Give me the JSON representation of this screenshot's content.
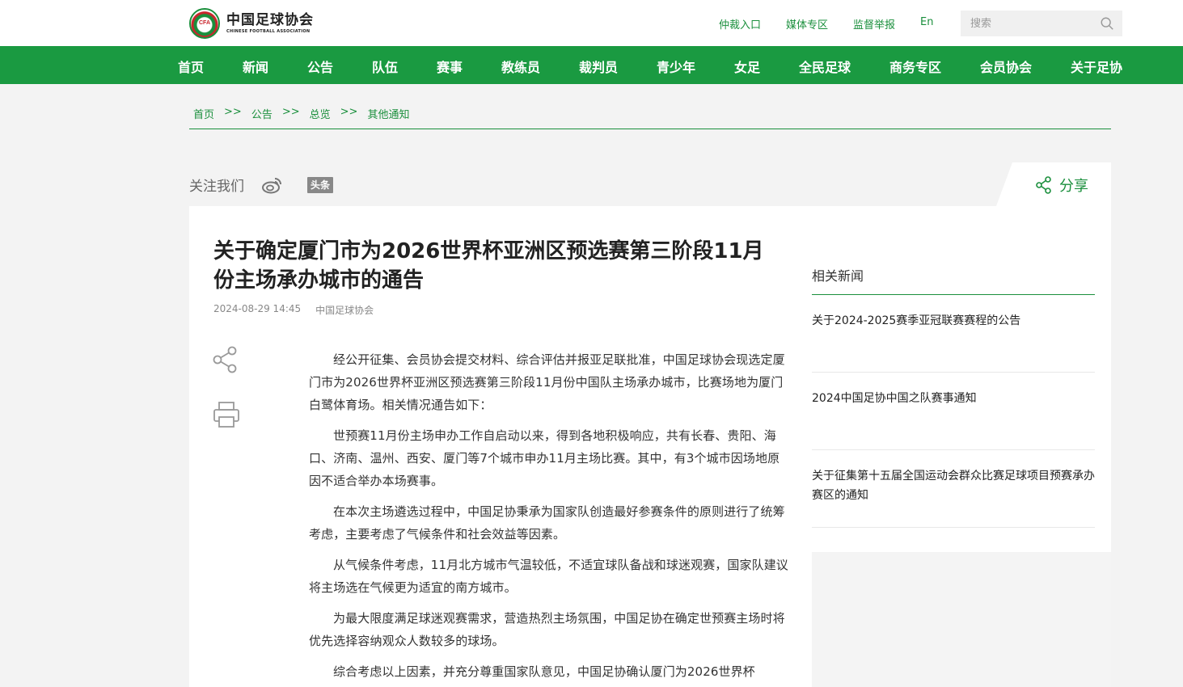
{
  "header": {
    "logo_cn": "中国足球协会",
    "logo_en": "CHINESE FOOTBALL ASSOCIATION",
    "logo_badge": "CFA",
    "links": [
      "仲裁入口",
      "媒体专区",
      "监督举报",
      "En"
    ],
    "search_placeholder": "搜索"
  },
  "nav": [
    "首页",
    "新闻",
    "公告",
    "队伍",
    "赛事",
    "教练员",
    "裁判员",
    "青少年",
    "女足",
    "全民足球",
    "商务专区",
    "会员协会",
    "关于足协"
  ],
  "breadcrumb": [
    "首页",
    "公告",
    "总览",
    "其他通知"
  ],
  "breadcrumb_sep": ">>",
  "follow": {
    "label": "关注我们",
    "toutiao": "头条"
  },
  "share_label": "分享",
  "article": {
    "title": "关于确定厦门市为2026世界杯亚洲区预选赛第三阶段11月份主场承办城市的通告",
    "date": "2024-08-29 14:45",
    "source": "中国足球协会",
    "paragraphs": [
      "经公开征集、会员协会提交材料、综合评估并报亚足联批准，中国足球协会现选定厦门市为2026世界杯亚洲区预选赛第三阶段11月份中国队主场承办城市，比赛场地为厦门白鹭体育场。相关情况通告如下：",
      "世预赛11月份主场申办工作自启动以来，得到各地积极响应，共有长春、贵阳、海口、济南、温州、西安、厦门等7个城市申办11月主场比赛。其中，有3个城市因场地原因不适合举办本场赛事。",
      "在本次主场遴选过程中，中国足协秉承为国家队创造最好参赛条件的原则进行了统筹考虑，主要考虑了气候条件和社会效益等因素。",
      "从气候条件考虑，11月北方城市气温较低，不适宜球队备战和球迷观赛，国家队建议将主场选在气候更为适宜的南方城市。",
      "为最大限度满足球迷观赛需求，营造热烈主场氛围，中国足协在确定世预赛主场时将优先选择容纳观众人数较多的球场。",
      "综合考虑以上因素，并充分尊重国家队意见，中国足协确认厦门为2026世界杯"
    ]
  },
  "related": {
    "title": "相关新闻",
    "items": [
      "关于2024-2025赛季亚冠联赛赛程的公告",
      "2024中国足协中国之队赛事通知",
      "关于征集第十五届全国运动会群众比赛足球项目预赛承办赛区的通知"
    ]
  },
  "colors": {
    "brand_green": "#1a9a41",
    "text_green": "#1a8f3c"
  }
}
